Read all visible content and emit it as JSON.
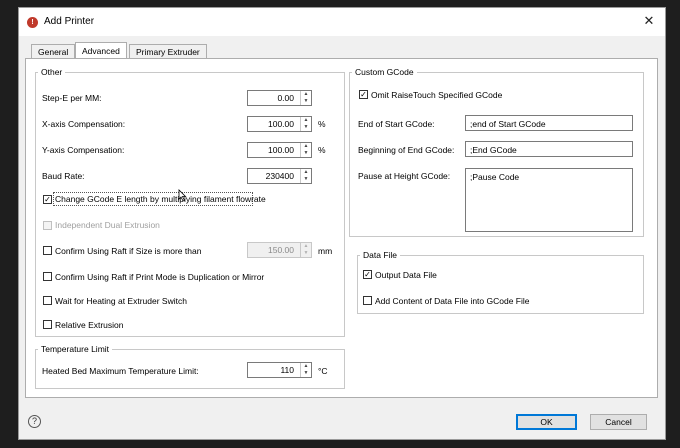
{
  "window": {
    "title": "Add Printer",
    "close_glyph": "✕",
    "app_icon_glyph": "!"
  },
  "tabs": [
    {
      "label": "General",
      "active": false
    },
    {
      "label": "Advanced",
      "active": true
    },
    {
      "label": "Primary Extruder",
      "active": false
    }
  ],
  "other": {
    "title": "Other",
    "step_e": {
      "label": "Step-E per MM:",
      "value": "0.00"
    },
    "x_comp": {
      "label": "X-axis Compensation:",
      "value": "100.00",
      "unit": "%"
    },
    "y_comp": {
      "label": "Y-axis Compensation:",
      "value": "100.00",
      "unit": "%"
    },
    "baud": {
      "label": "Baud Rate:",
      "value": "230400"
    },
    "change_gcode": {
      "label": "Change GCode E length by multiplying filament flowrate",
      "checked": true
    },
    "dual_extrusion": {
      "label": "Independent Dual Extrusion",
      "checked": false,
      "disabled": true
    },
    "raft_size": {
      "label": "Confirm Using Raft if Size is more than",
      "value": "150.00",
      "unit": "mm",
      "checked": false
    },
    "raft_mode": {
      "label": "Confirm Using Raft if Print Mode is Duplication or Mirror",
      "checked": false
    },
    "wait_heating": {
      "label": "Wait for Heating at Extruder Switch",
      "checked": false
    },
    "relative_extrusion": {
      "label": "Relative Extrusion",
      "checked": false
    }
  },
  "temperature": {
    "title": "Temperature Limit",
    "bed_max": {
      "label": "Heated Bed Maximum Temperature Limit:",
      "value": "110",
      "unit": "°C"
    }
  },
  "custom_gcode": {
    "title": "Custom GCode",
    "omit": {
      "label": "Omit RaiseTouch Specified GCode",
      "checked": true
    },
    "end_start": {
      "label": "End of Start GCode:",
      "value": ";end of Start GCode"
    },
    "begin_end": {
      "label": "Beginning of End GCode:",
      "value": ";End GCode"
    },
    "pause": {
      "label": "Pause at Height GCode:",
      "value": ";Pause Code"
    }
  },
  "data_file": {
    "title": "Data File",
    "output": {
      "label": "Output Data File",
      "checked": true
    },
    "add_content": {
      "label": "Add Content of Data File into GCode File",
      "checked": false
    }
  },
  "footer": {
    "help_glyph": "?",
    "ok_label": "OK",
    "cancel_label": "Cancel"
  },
  "glyphs": {
    "check": "✓",
    "spin_up": "▲",
    "spin_down": "▼",
    "cursor": "pointer-hand"
  },
  "colors": {
    "accent": "#0078d7",
    "app_icon": "#c0392b"
  }
}
